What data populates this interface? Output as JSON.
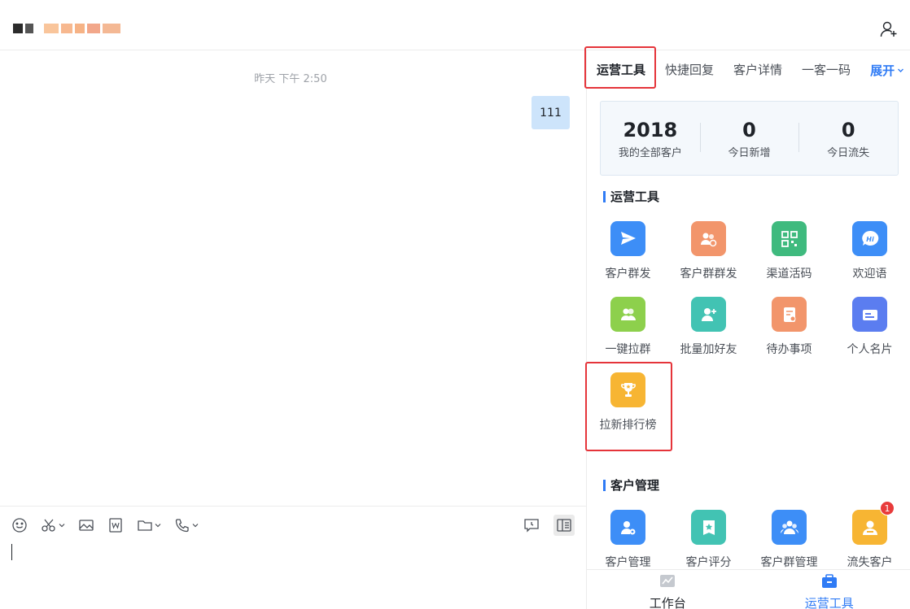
{
  "header": {
    "title_blur_colors": [
      "#2b2b2b",
      "#555555",
      "#f7b27a",
      "#f4a06a",
      "#f39a5e",
      "#ee8a63",
      "#f0a070"
    ]
  },
  "chat": {
    "timestamp": "昨天 下午 2:50",
    "messages": [
      {
        "text": "111",
        "from": "me"
      }
    ]
  },
  "panel": {
    "tabs": [
      {
        "label": "运营工具",
        "active": true
      },
      {
        "label": "快捷回复",
        "active": false
      },
      {
        "label": "客户详情",
        "active": false
      },
      {
        "label": "一客一码",
        "active": false
      }
    ],
    "expand_label": "展开",
    "stats": [
      {
        "value": "2018",
        "label": "我的全部客户"
      },
      {
        "value": "0",
        "label": "今日新增"
      },
      {
        "value": "0",
        "label": "今日流失"
      }
    ],
    "sections": [
      {
        "title": "运营工具",
        "items": [
          {
            "label": "客户群发",
            "icon": "paper-plane-icon",
            "color": "#3d8ef7"
          },
          {
            "label": "客户群群发",
            "icon": "group-send-icon",
            "color": "#f2956b"
          },
          {
            "label": "渠道活码",
            "icon": "qr-code-icon",
            "color": "#3fba7e"
          },
          {
            "label": "欢迎语",
            "icon": "hi-bubble-icon",
            "color": "#3d8ef7"
          },
          {
            "label": "一键拉群",
            "icon": "group-icon",
            "color": "#8dd04c"
          },
          {
            "label": "批量加好友",
            "icon": "add-friend-icon",
            "color": "#42c3b3"
          },
          {
            "label": "待办事项",
            "icon": "todo-icon",
            "color": "#f2956b"
          },
          {
            "label": "个人名片",
            "icon": "id-card-icon",
            "color": "#5b7df0"
          },
          {
            "label": "拉新排行榜",
            "icon": "trophy-icon",
            "color": "#f7b533"
          }
        ]
      },
      {
        "title": "客户管理",
        "items": [
          {
            "label": "客户管理",
            "icon": "user-gear-icon",
            "color": "#3d8ef7"
          },
          {
            "label": "客户评分",
            "icon": "star-card-icon",
            "color": "#42c3b3"
          },
          {
            "label": "客户群管理",
            "icon": "group-manage-icon",
            "color": "#3d8ef7"
          },
          {
            "label": "流失客户",
            "icon": "lost-user-icon",
            "color": "#f7b533",
            "badge": "1"
          }
        ]
      }
    ],
    "bottom_nav": [
      {
        "label": "工作台",
        "icon": "chart-icon",
        "active": false
      },
      {
        "label": "运营工具",
        "icon": "toolbox-icon",
        "active": true
      }
    ]
  }
}
